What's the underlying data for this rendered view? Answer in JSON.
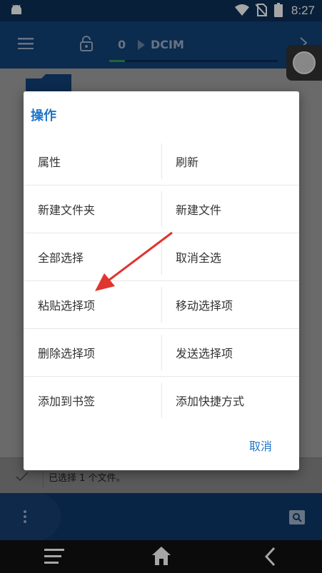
{
  "status_bar": {
    "time": "8:27"
  },
  "app_bar": {
    "path_count": "0",
    "path_label": "DCIM"
  },
  "status_strip": {
    "text": "已选择 1 个文件。"
  },
  "dialog": {
    "title": "操作",
    "cancel_label": "取消",
    "rows": [
      {
        "left": "属性",
        "right": "刷新"
      },
      {
        "left": "新建文件夹",
        "right": "新建文件"
      },
      {
        "left": "全部选择",
        "right": "取消全选"
      },
      {
        "left": "粘贴选择项",
        "right": "移动选择项"
      },
      {
        "left": "删除选择项",
        "right": "发送选择项"
      },
      {
        "left": "添加到书签",
        "right": "添加快捷方式"
      }
    ]
  },
  "colors": {
    "accent": "#1e75c8",
    "app_bar": "#11437a",
    "arrow": "#e0342f"
  },
  "icons": [
    "android-icon",
    "wifi-icon",
    "no-sim-icon",
    "battery-icon",
    "menu-icon",
    "lock-icon",
    "chevron-right-icon",
    "folder-icon",
    "check-icon",
    "more-vert-icon",
    "search-icon",
    "nav-menu-icon",
    "home-icon",
    "back-icon"
  ]
}
